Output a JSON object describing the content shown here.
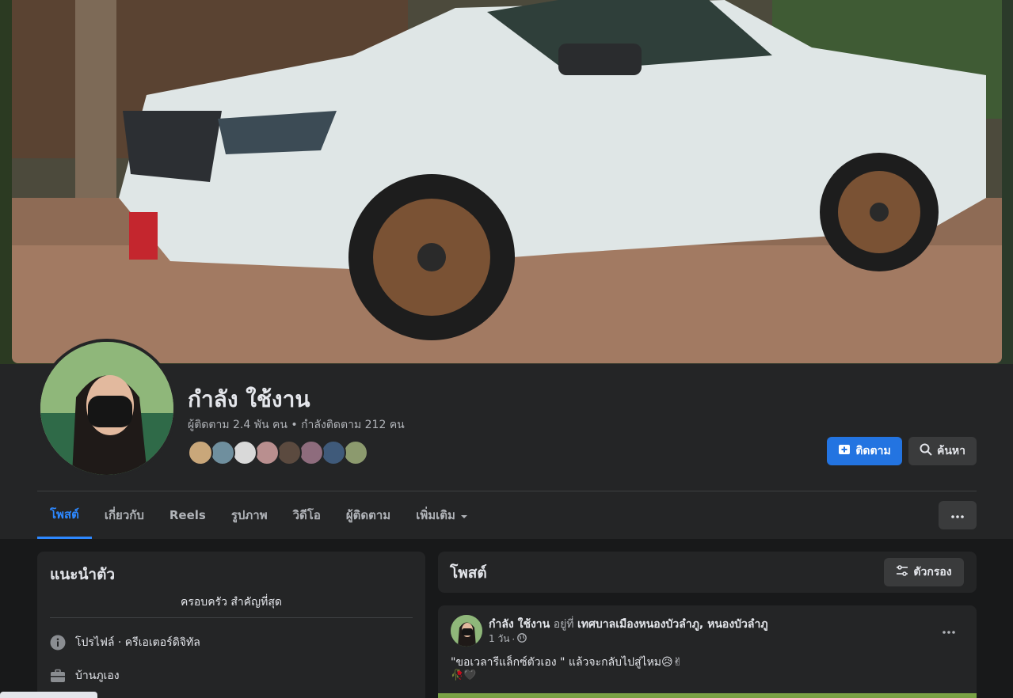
{
  "profile": {
    "name": "กำลัง ใช้งาน",
    "stats": "ผู้ติดตาม 2.4 พัน คน • กำลังติดตาม 212 คน",
    "follower_avatar_colors": [
      "#c9a77a",
      "#6f8f9e",
      "#d9d9d9",
      "#b98f8f",
      "#5b4a3f",
      "#8e6c7d",
      "#3f5a7a",
      "#8c9a6e"
    ]
  },
  "actions": {
    "follow_label": "ติดตาม",
    "search_label": "ค้นหา",
    "follow_icon": "follow-plus-icon",
    "search_icon": "search-icon",
    "more_icon": "more-horizontal-icon"
  },
  "tabs": [
    {
      "label": "โพสต์",
      "active": true
    },
    {
      "label": "เกี่ยวกับ",
      "active": false
    },
    {
      "label": "Reels",
      "active": false
    },
    {
      "label": "รูปภาพ",
      "active": false
    },
    {
      "label": "วิดีโอ",
      "active": false
    },
    {
      "label": "ผู้ติดตาม",
      "active": false
    },
    {
      "label": "เพิ่มเติม",
      "active": false
    }
  ],
  "intro": {
    "title": "แนะนำตัว",
    "bio": "ครอบครัว สำคัญที่สุด",
    "rows": [
      {
        "icon": "info-icon",
        "label": "โปรไฟล์ · ครีเอเตอร์ดิจิทัล"
      },
      {
        "icon": "briefcase-icon",
        "label": "บ้านภูเอง"
      }
    ]
  },
  "posts_section": {
    "title": "โพสต์",
    "filter_label": "ตัวกรอง",
    "filter_icon": "filter-sliders-icon"
  },
  "post": {
    "author": "กำลัง ใช้งาน",
    "at_word": "อยู่ที่",
    "place": "เทศบาลเมืองหนองบัวลำภู, หนองบัวลำภู",
    "time": "1 วัน",
    "privacy_icon": "globe-icon",
    "text": "\"ขอเวลารีแล็กซ์ตัวเอง \" แล้วจะกลับไปสู่ไหม😥✌",
    "emoji": "🥀🖤"
  },
  "colors": {
    "accent": "#2d88ff",
    "follow_button": "#2374e1",
    "surface": "#242526",
    "background": "#18191a"
  }
}
